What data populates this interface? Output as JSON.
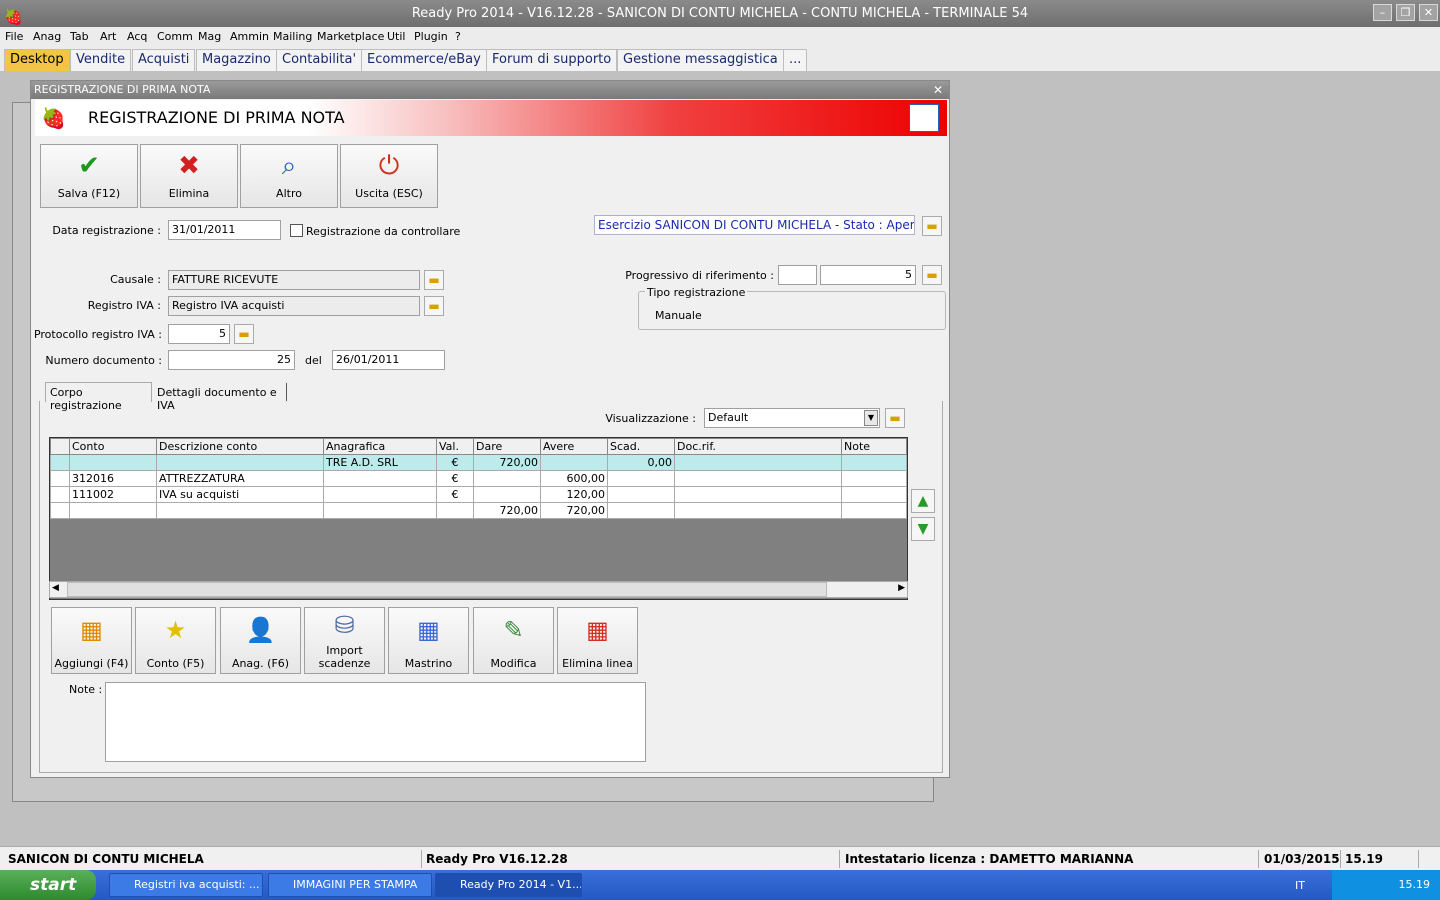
{
  "window": {
    "title": "Ready Pro 2014 - V16.12.28 - SANICON DI CONTU MICHELA - CONTU MICHELA - TERMINALE 54"
  },
  "menu": [
    "File",
    "Anag",
    "Tab",
    "Art",
    "Acq",
    "Comm",
    "Mag",
    "Ammin",
    "Mailing",
    "Marketplace",
    "Util",
    "Plugin",
    "?"
  ],
  "tabs": [
    "Desktop",
    "Vendite",
    "Acquisti",
    "Magazzino",
    "Contabilita'",
    "Ecommerce/eBay",
    "Forum di supporto",
    "Gestione messaggistica",
    "..."
  ],
  "dialog": {
    "title_bar": "REGISTRAZIONE DI PRIMA NOTA",
    "heading": "REGISTRAZIONE DI PRIMA NOTA",
    "toolbar": {
      "save": "Salva (F12)",
      "delete": "Elimina",
      "other": "Altro",
      "exit": "Uscita (ESC)"
    },
    "data_registrazione_label": "Data registrazione :",
    "data_registrazione": "31/01/2011",
    "da_controllare_label": "Registrazione da controllare",
    "esercizio": "Esercizio SANICON DI CONTU MICHELA - Stato : Aperto",
    "causale_label": "Causale :",
    "causale": "FATTURE RICEVUTE",
    "registro_label": "Registro IVA :",
    "registro": "Registro IVA acquisti",
    "protocollo_label": "Protocollo registro IVA :",
    "protocollo": "5",
    "numdoc_label": "Numero documento :",
    "numdoc": "25",
    "del_label": "del",
    "data_doc": "26/01/2011",
    "progressivo_label": "Progressivo di riferimento :",
    "progressivo": "5",
    "tipo_label": "Tipo registrazione",
    "tipo": "Manuale",
    "subtabs": [
      "Corpo registrazione",
      "Dettagli documento e IVA"
    ],
    "visual_label": "Visualizzazione :",
    "visual": "Default",
    "columns": [
      "Conto",
      "Descrizione conto",
      "Anagrafica",
      "Val.",
      "Dare",
      "Avere",
      "Scad.",
      "Doc.rif.",
      "Note"
    ],
    "rows": [
      [
        "",
        "",
        "TRE A.D. SRL",
        "€",
        "720,00",
        "",
        "0,00",
        "",
        ""
      ],
      [
        "312016",
        "ATTREZZATURA",
        "",
        "€",
        "",
        "600,00",
        "",
        "",
        ""
      ],
      [
        "111002",
        "IVA su acquisti",
        "",
        "€",
        "",
        "120,00",
        "",
        "",
        ""
      ],
      [
        "",
        "",
        "",
        "",
        "720,00",
        "720,00",
        "",
        "",
        ""
      ]
    ],
    "bottom_buttons": [
      "Aggiungi (F4)",
      "Conto (F5)",
      "Anag. (F6)",
      "Import scadenze",
      "Mastrino",
      "Modifica",
      "Elimina linea"
    ],
    "note_label": "Note :"
  },
  "status": {
    "company": "SANICON DI CONTU MICHELA",
    "version": "Ready Pro V16.12.28",
    "license": "Intestatario licenza : DAMETTO MARIANNA",
    "date": "01/03/2015",
    "time": "15.19"
  },
  "taskbar": {
    "start": "start",
    "tasks": [
      "Registri iva acquisti: ...",
      "IMMAGINI PER STAMPA",
      "Ready Pro 2014 - V1..."
    ],
    "lang": "IT",
    "clock": "15.19"
  }
}
